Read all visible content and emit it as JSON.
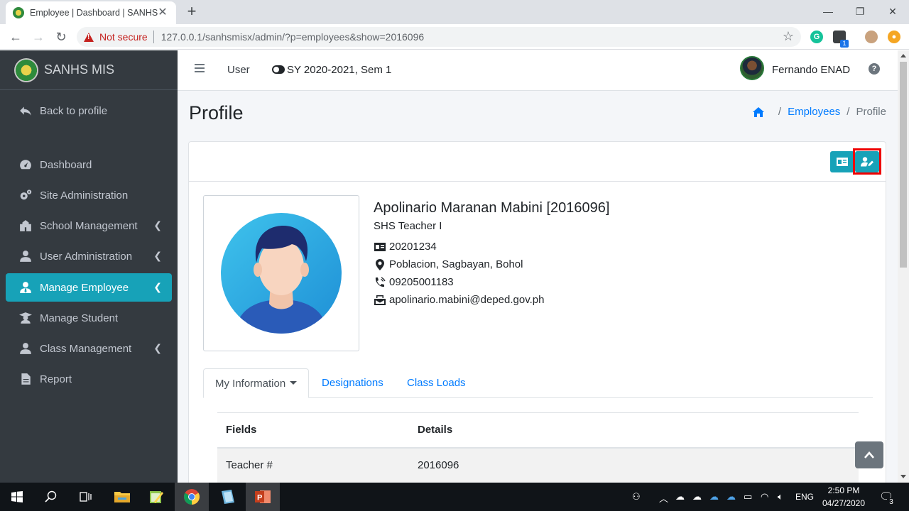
{
  "browser": {
    "tab_title": "Employee | Dashboard | SANHS M",
    "not_secure": "Not secure",
    "url": "127.0.0.1/sanhsmisx/admin/?p=employees&show=2016096",
    "ext_badge": "1"
  },
  "sidebar": {
    "brand": "SANHS MIS",
    "items": [
      {
        "label": "Back to profile",
        "icon": "back-arrow-icon"
      },
      {
        "label": "Dashboard",
        "icon": "tachometer-icon"
      },
      {
        "label": "Site Administration",
        "icon": "cogs-icon"
      },
      {
        "label": "School Management",
        "icon": "school-icon"
      },
      {
        "label": "User Administration",
        "icon": "user-icon"
      },
      {
        "label": "Manage Employee",
        "icon": "user-tie-icon"
      },
      {
        "label": "Manage Student",
        "icon": "graduate-icon"
      },
      {
        "label": "Class Management",
        "icon": "user-icon"
      },
      {
        "label": "Report",
        "icon": "file-icon"
      }
    ]
  },
  "topnav": {
    "user_label": "User",
    "school_year": "SY 2020-2021, Sem 1",
    "user_name": "Fernando ENAD"
  },
  "page": {
    "title": "Profile",
    "breadcrumb": [
      "Employees",
      "Profile"
    ]
  },
  "profile": {
    "name": "Apolinario Maranan Mabini [2016096]",
    "position": "SHS Teacher I",
    "id_number": "20201234",
    "address": "Poblacion, Sagbayan, Bohol",
    "phone": "09205001183",
    "email": "apolinario.mabini@deped.gov.ph"
  },
  "tabs": [
    "My Information",
    "Designations",
    "Class Loads"
  ],
  "table": {
    "headers": [
      "Fields",
      "Details"
    ],
    "rows": [
      [
        "Teacher #",
        "2016096"
      ]
    ]
  },
  "taskbar": {
    "lang": "ENG",
    "time": "2:50 PM",
    "date": "04/27/2020",
    "notif_count": "3"
  },
  "colors": {
    "sidebar_bg": "#343a40",
    "accent": "#17a2b8",
    "link": "#007bff",
    "highlight": "#ee0000"
  }
}
